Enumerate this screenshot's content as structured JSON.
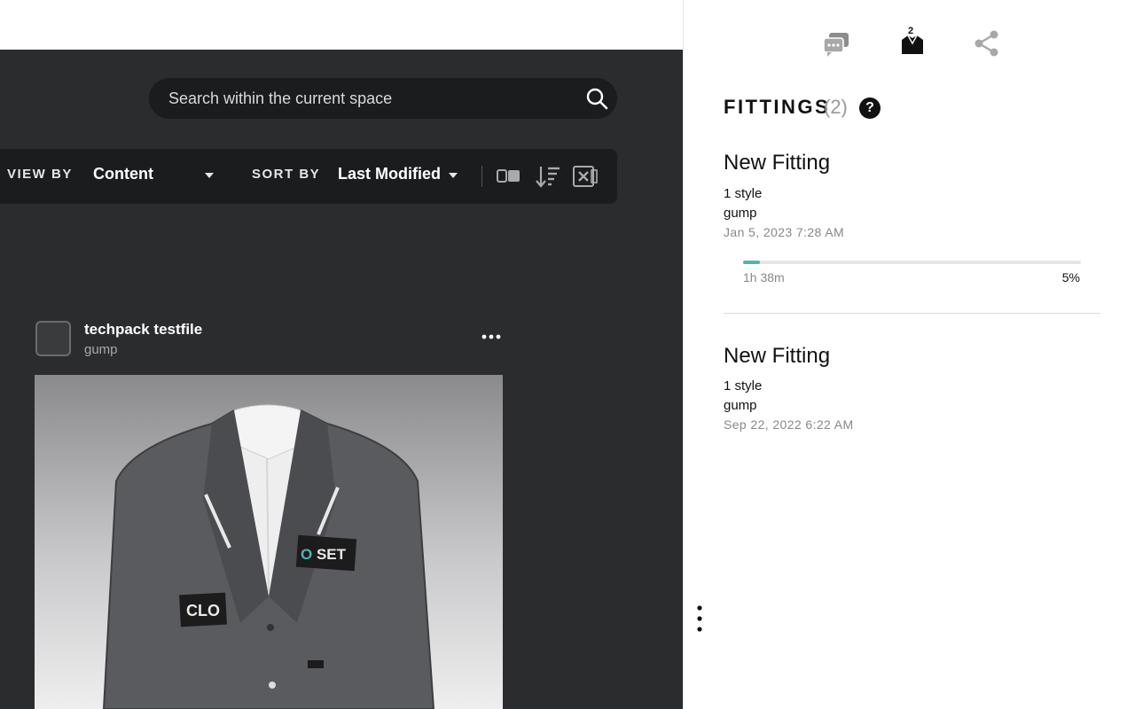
{
  "main": {
    "search": {
      "placeholder": "Search within the current space",
      "icon": "search-icon"
    },
    "toolbar": {
      "view_by_label": "VIEW BY",
      "view_by_value": "Content",
      "sort_by_label": "SORT BY",
      "sort_by_value": "Last Modified",
      "icons": [
        "view-toggle-icon",
        "sort-order-icon",
        "export-excel-icon"
      ]
    },
    "card": {
      "title": "techpack testfile",
      "owner": "gump",
      "thumbnail_badges": [
        "CLOSET",
        "CLO"
      ]
    }
  },
  "panel": {
    "tab_icons": [
      "comments-icon",
      "fitting-icon",
      "share-icon"
    ],
    "active_tab": "fitting-icon",
    "fitting_count_badge": "2",
    "title": "FITTINGS",
    "count": "(2)",
    "help_label": "?",
    "fittings": [
      {
        "name": "New Fitting",
        "styles": "1 style",
        "owner": "gump",
        "date": "Jan 5, 2023 7:28 AM",
        "progress_time": "1h 38m",
        "progress_label": "5%",
        "progress_fraction": 0.05
      },
      {
        "name": "New Fitting",
        "styles": "1 style",
        "owner": "gump",
        "date": "Sep 22, 2022 6:22 AM"
      }
    ]
  },
  "colors": {
    "accent": "#4fb5b6",
    "dark_bg": "#2b2c2e",
    "toolbar_bg": "#1b1c1d"
  }
}
